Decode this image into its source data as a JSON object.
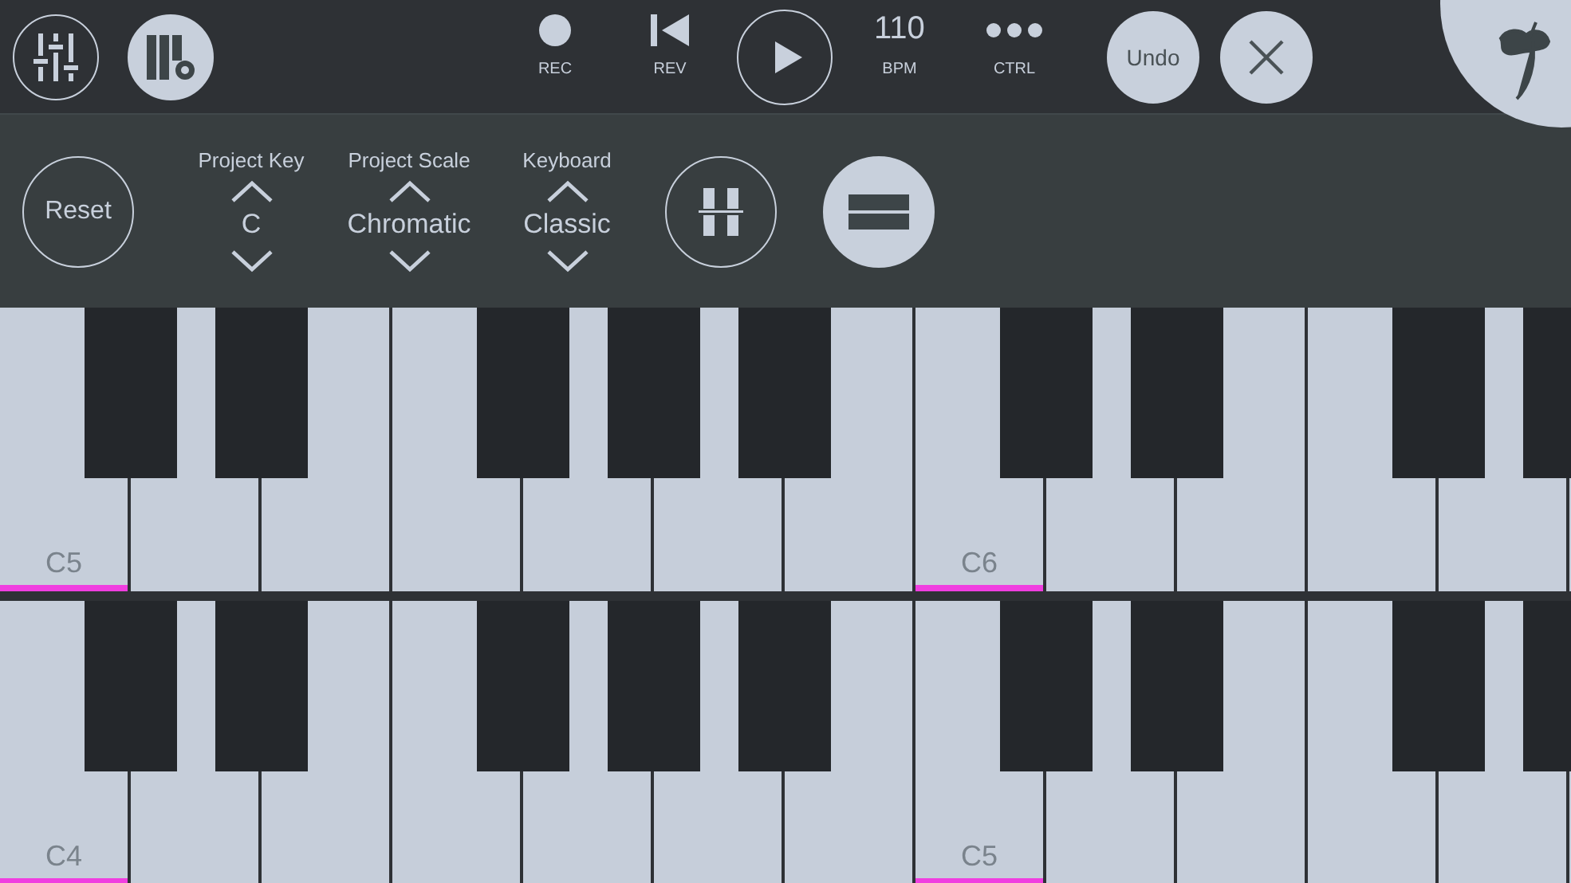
{
  "toolbar": {
    "left_buttons": [
      {
        "kind": "mixer",
        "selected": false
      },
      {
        "kind": "piano-settings",
        "selected": true
      }
    ],
    "transport": [
      {
        "kind": "rec",
        "caption": "REC"
      },
      {
        "kind": "rev",
        "caption": "REV"
      },
      {
        "kind": "play"
      },
      {
        "kind": "bpm",
        "value": "110",
        "caption": "BPM"
      },
      {
        "kind": "ctrl",
        "caption": "CTRL"
      }
    ],
    "undo": "Undo"
  },
  "controls": {
    "reset": "Reset",
    "spinners": [
      {
        "label": "Project Key",
        "value": "C"
      },
      {
        "label": "Project Scale",
        "value": "Chromatic"
      },
      {
        "label": "Keyboard",
        "value": "Classic"
      }
    ],
    "layout_buttons": [
      {
        "kind": "split",
        "selected": false
      },
      {
        "kind": "single",
        "selected": true
      }
    ]
  },
  "keyboard": {
    "rows": [
      {
        "octaves": [
          {
            "label": "C5"
          },
          {
            "label": "C6"
          }
        ]
      },
      {
        "octaves": [
          {
            "label": "C4"
          },
          {
            "label": "C5"
          }
        ]
      }
    ]
  }
}
